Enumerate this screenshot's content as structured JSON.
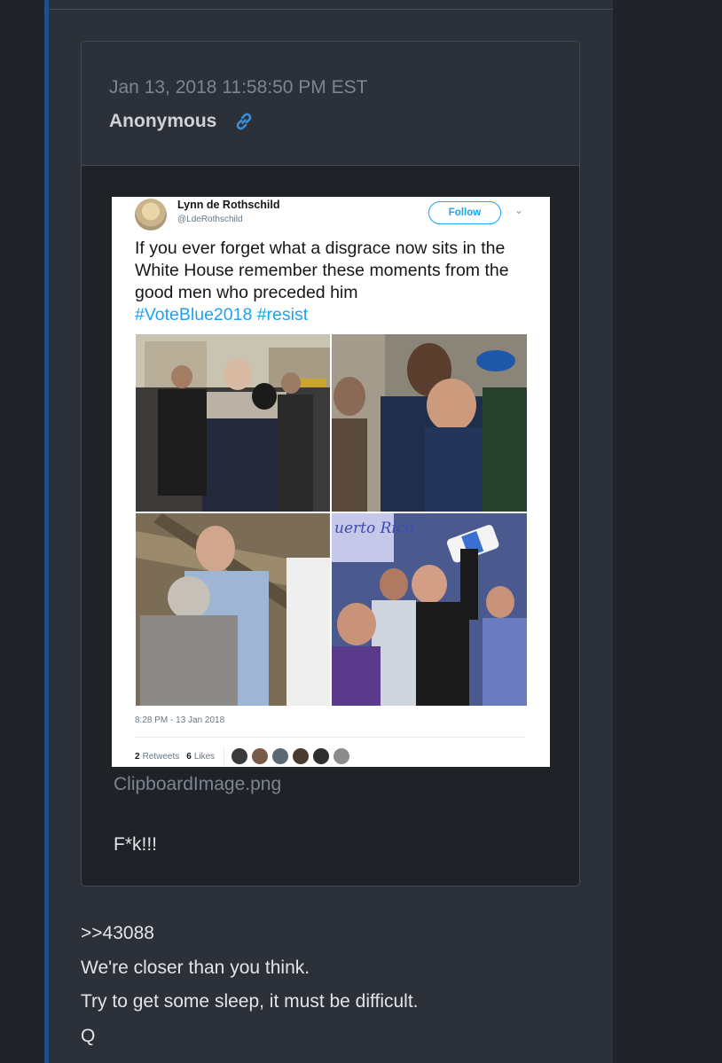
{
  "post": {
    "date": "Jan 13, 2018 11:58:50 PM EST",
    "author": "Anonymous",
    "link_icon": "link-icon",
    "attachment_filename": "ClipboardImage.png",
    "message": "F*k!!!"
  },
  "tweet": {
    "name": "Lynn de Rothschild",
    "handle": "@LdeRothschild",
    "follow_label": "Follow",
    "text": "If you ever forget what a disgrace now sits in the White House remember these moments from the good men who preceded him",
    "hashtags": "#VoteBlue2018 #resist",
    "timestamp": "8:28 PM - 13 Jan 2018",
    "retweets_count": "2",
    "retweets_label": "Retweets",
    "likes_count": "6",
    "likes_label": "Likes",
    "banner_text": "uerto Rico"
  },
  "reply": {
    "quote_ref": ">>43088",
    "line1": "We're closer than you think.",
    "line2": "Try to get some sleep, it must be difficult.",
    "signature": "Q"
  },
  "colors": {
    "accent_bar": "#1e4f8f",
    "panel_bg": "#2c3139",
    "page_bg": "#1f2227",
    "link_blue": "#3b8fd9",
    "twitter_blue": "#1da1f2"
  }
}
